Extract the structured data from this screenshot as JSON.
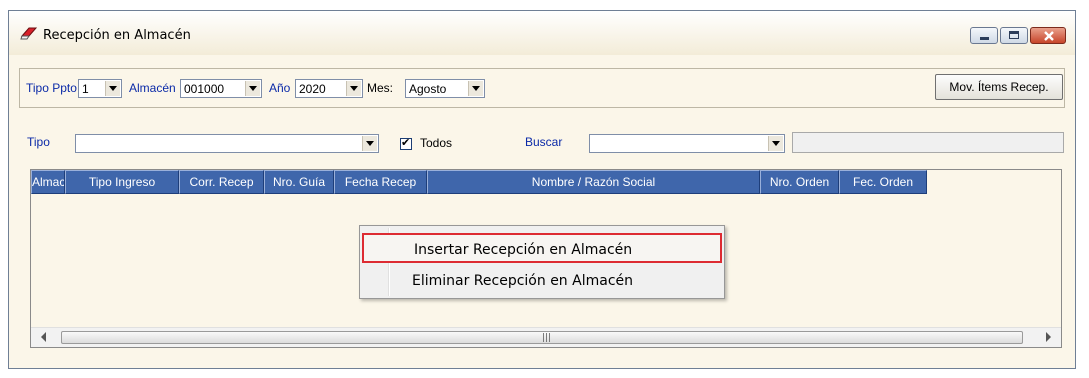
{
  "window": {
    "title": "Recepción en Almacén",
    "icons": {
      "app": "eraser-icon",
      "min": "minimize-icon",
      "max": "maximize-icon",
      "close": "close-icon"
    },
    "close_color": "#c7452a"
  },
  "filters": {
    "tipo_ppto_label": "Tipo Ppto",
    "tipo_ppto_value": "1",
    "almacen_label": "Almacén",
    "almacen_value": "001000",
    "anio_label": "Año",
    "anio_value": "2020",
    "mes_label": "Mes:",
    "mes_value": "Agosto",
    "mov_button": "Mov. Ítems Recep.",
    "tipo_label": "Tipo",
    "tipo_value": "",
    "todos_label": "Todos",
    "todos_checked": true,
    "buscar_label": "Buscar",
    "buscar_value": "",
    "search_text": ""
  },
  "grid": {
    "columns": [
      "Almac.",
      "Tipo Ingreso",
      "Corr. Recep",
      "Nro. Guía",
      "Fecha Recep",
      "Nombre / Razón Social",
      "Nro. Orden",
      "Fec. Orden"
    ],
    "header_color": "#3f66ab",
    "rows": []
  },
  "context_menu": {
    "items": [
      "Insertar Recepción en Almacén",
      "Eliminar Recepción en Almacén"
    ],
    "highlight_color": "#dd2b32"
  }
}
